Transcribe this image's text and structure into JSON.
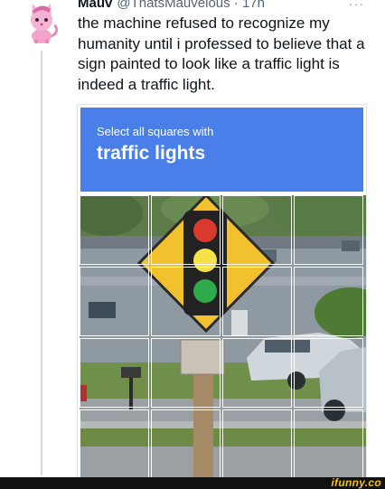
{
  "tweet": {
    "author_name": "Mauv",
    "handle_time": "@ThatsMauvelous · 17h",
    "text": "the machine refused to recognize my humanity until i professed to believe that a sign painted to look like a traffic light is indeed a traffic light."
  },
  "captcha": {
    "instruction": "Select all squares with",
    "target": "traffic lights",
    "header_color": "#4a7ee8",
    "grid_rows": 4,
    "grid_cols": 4
  },
  "watermark": {
    "text": "ifunny.co",
    "color": "#f5c400"
  },
  "icons": [
    "avatar-cat-icon",
    "more-options-icon"
  ]
}
